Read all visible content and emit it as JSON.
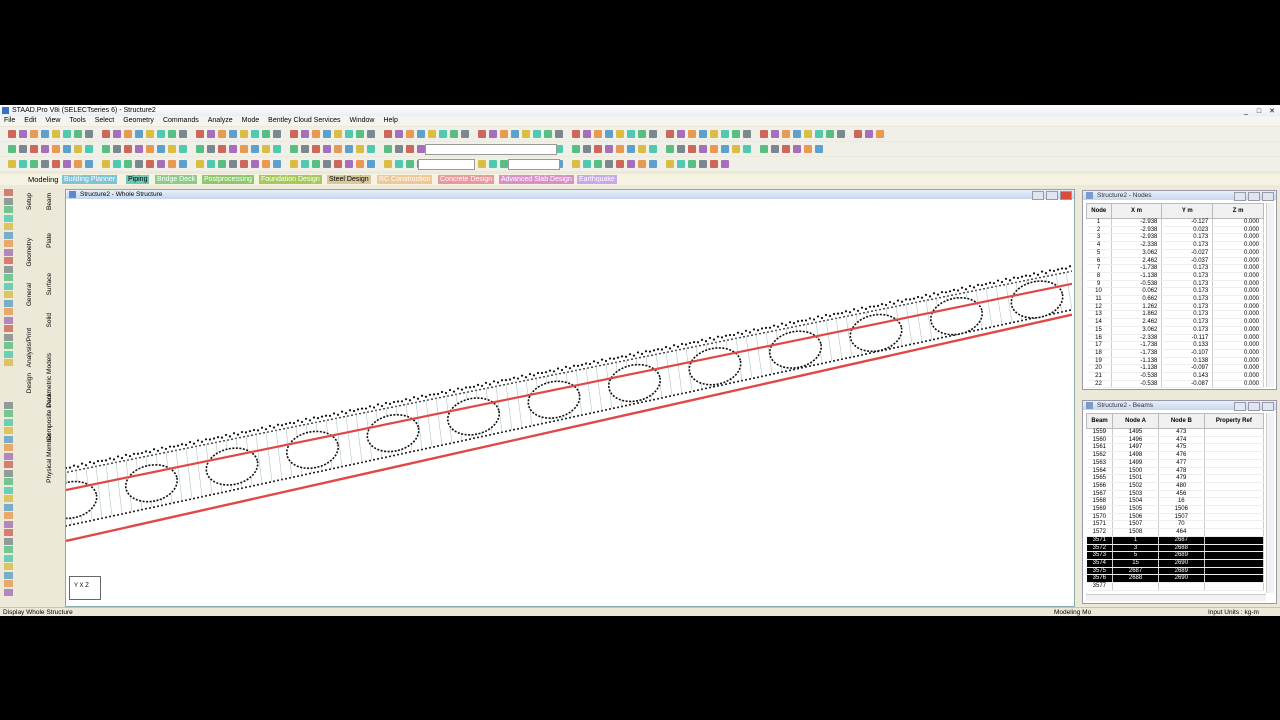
{
  "window": {
    "title": "STAAD.Pro V8i (SELECTseries 6) - Structure2"
  },
  "menu": [
    "File",
    "Edit",
    "View",
    "Tools",
    "Select",
    "Geometry",
    "Commands",
    "Analyze",
    "Mode",
    "Bentley Cloud Services",
    "Window",
    "Help"
  ],
  "workflow_tabs": [
    {
      "label": "Modeling",
      "color": "#000000",
      "bg": "transparent"
    },
    {
      "label": "Building Planner",
      "color": "#ffffff",
      "bg": "#7ec3d6"
    },
    {
      "label": "Piping",
      "color": "#000000",
      "bg": "#6ec9b8"
    },
    {
      "label": "Bridge Deck",
      "color": "#ffffff",
      "bg": "#8ccb8a"
    },
    {
      "label": "Postprocessing",
      "color": "#ffffff",
      "bg": "#8cc86c"
    },
    {
      "label": "Foundation Design",
      "color": "#ffffff",
      "bg": "#a8c85a"
    },
    {
      "label": "Steel Design",
      "color": "#000000",
      "bg": "#d8c89c"
    },
    {
      "label": "RC Construction",
      "color": "#ffffff",
      "bg": "#f0c898"
    },
    {
      "label": "Concrete Design",
      "color": "#ffffff",
      "bg": "#e898a0"
    },
    {
      "label": "Advanced Slab Design",
      "color": "#ffffff",
      "bg": "#d890c8"
    },
    {
      "label": "Earthquake",
      "color": "#ffffff",
      "bg": "#c8a8e8"
    }
  ],
  "side_tabs": {
    "col1": [
      "Setup",
      "Geometry",
      "General",
      "Analysis/Print",
      "Design"
    ],
    "col2": [
      "Beam",
      "Plate",
      "Surface",
      "Solid",
      "Parametric Models",
      "Composite Deck",
      "Physical Member"
    ]
  },
  "main_window": {
    "title": "Structure2 - Whole Structure",
    "axis_label": "Y X Z"
  },
  "nodes_panel": {
    "title": "Structure2 - Nodes",
    "headers": [
      "Node",
      "X\nm",
      "Y\nm",
      "Z\nm"
    ],
    "rows": [
      [
        "1",
        "-2.938",
        "-0.127",
        "0.000"
      ],
      [
        "2",
        "-2.938",
        "0.023",
        "0.000"
      ],
      [
        "3",
        "-2.938",
        "0.173",
        "0.000"
      ],
      [
        "4",
        "-2.338",
        "0.173",
        "0.000"
      ],
      [
        "5",
        "3.062",
        "-0.027",
        "0.000"
      ],
      [
        "6",
        "2.462",
        "-0.037",
        "0.000"
      ],
      [
        "7",
        "-1.738",
        "0.173",
        "0.000"
      ],
      [
        "8",
        "-1.138",
        "0.173",
        "0.000"
      ],
      [
        "9",
        "-0.538",
        "0.173",
        "0.000"
      ],
      [
        "10",
        "0.062",
        "0.173",
        "0.000"
      ],
      [
        "11",
        "0.662",
        "0.173",
        "0.000"
      ],
      [
        "12",
        "1.262",
        "0.173",
        "0.000"
      ],
      [
        "13",
        "1.862",
        "0.173",
        "0.000"
      ],
      [
        "14",
        "2.462",
        "0.173",
        "0.000"
      ],
      [
        "15",
        "3.062",
        "0.173",
        "0.000"
      ],
      [
        "16",
        "-2.338",
        "-0.117",
        "0.000"
      ],
      [
        "17",
        "-1.738",
        "0.133",
        "0.000"
      ],
      [
        "18",
        "-1.738",
        "-0.107",
        "0.000"
      ],
      [
        "19",
        "-1.138",
        "0.138",
        "0.000"
      ],
      [
        "20",
        "-1.138",
        "-0.097",
        "0.000"
      ],
      [
        "21",
        "-0.538",
        "0.143",
        "0.000"
      ],
      [
        "22",
        "-0.538",
        "-0.087",
        "0.000"
      ]
    ]
  },
  "beams_panel": {
    "title": "Structure2 - Beams",
    "headers": [
      "Beam",
      "Node A",
      "Node B",
      "Property Ref"
    ],
    "rows": [
      [
        "1559",
        "1495",
        "473",
        ""
      ],
      [
        "1560",
        "1496",
        "474",
        ""
      ],
      [
        "1561",
        "1497",
        "475",
        ""
      ],
      [
        "1562",
        "1498",
        "476",
        ""
      ],
      [
        "1563",
        "1499",
        "477",
        ""
      ],
      [
        "1564",
        "1500",
        "478",
        ""
      ],
      [
        "1565",
        "1501",
        "479",
        ""
      ],
      [
        "1566",
        "1502",
        "480",
        ""
      ],
      [
        "1567",
        "1503",
        "456",
        ""
      ],
      [
        "1568",
        "1504",
        "16",
        ""
      ],
      [
        "1569",
        "1505",
        "1506",
        ""
      ],
      [
        "1570",
        "1506",
        "1507",
        ""
      ],
      [
        "1571",
        "1507",
        "70",
        ""
      ],
      [
        "1572",
        "1508",
        "464",
        ""
      ],
      [
        "3571",
        "1",
        "2687",
        ""
      ],
      [
        "3572",
        "3",
        "2688",
        ""
      ],
      [
        "3573",
        "5",
        "2689",
        ""
      ],
      [
        "3574",
        "15",
        "2690",
        ""
      ],
      [
        "3575",
        "2687",
        "2689",
        ""
      ],
      [
        "3576",
        "2688",
        "2690",
        ""
      ],
      [
        "3577",
        "",
        ""
      ]
    ],
    "selected_from": 14,
    "selected_to": 19
  },
  "status": {
    "left": "Display Whole Structure",
    "middle": "Modeling Mo",
    "right": "Input Units : kg-m"
  }
}
